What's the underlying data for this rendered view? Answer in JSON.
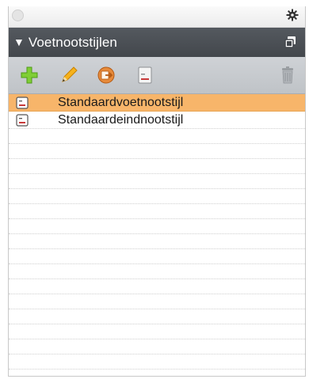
{
  "panel": {
    "title": "Voetnootstijlen"
  },
  "toolbar": {
    "tools": [
      {
        "name": "add-style-button",
        "icon": "plus-icon"
      },
      {
        "name": "edit-style-button",
        "icon": "pencil-icon"
      },
      {
        "name": "load-style-button",
        "icon": "load-icon"
      },
      {
        "name": "duplicate-style-button",
        "icon": "document-icon"
      },
      {
        "name": "delete-style-button",
        "icon": "trash-icon"
      }
    ]
  },
  "styles": [
    {
      "label": "Standaardvoetnootstijl",
      "selected": true
    },
    {
      "label": "Standaardeindnootstijl",
      "selected": false
    }
  ],
  "colors": {
    "selection": "#f7b56a",
    "title_bar": "#4a4e53",
    "toolbar": "#c7cacd",
    "add_icon": "#6cbf2a",
    "edit_icon": "#f2a300",
    "load_icon": "#e07a2a"
  }
}
